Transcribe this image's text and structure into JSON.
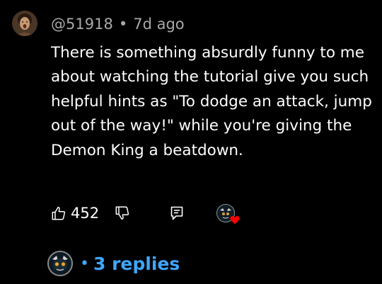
{
  "comment": {
    "handle": "@51918",
    "separator": "•",
    "time_ago": "7d ago",
    "text": "There is something absurdly funny to me about watching the tutorial give you such helpful hints as \"To dodge an attack, jump out of the way!\" while you're giving the Demon King a beatdown.",
    "avatar_icon": "user-avatar"
  },
  "actions": {
    "like_icon": "thumbs-up-icon",
    "like_count": "452",
    "dislike_icon": "thumbs-down-icon",
    "reply_icon": "reply-comment-icon",
    "creator_heart_icon": "creator-heart-icon",
    "heart_color": "#ff0000"
  },
  "replies": {
    "separator": "•",
    "label": "3 replies",
    "avatar_icon": "replier-avatar",
    "link_color": "#3ea6ff"
  }
}
